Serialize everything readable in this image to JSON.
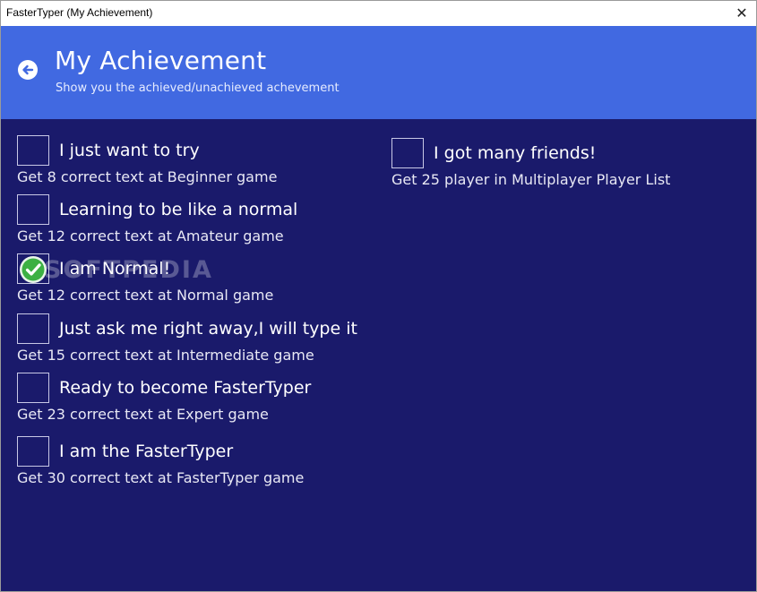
{
  "window": {
    "title": "FasterTyper (My Achievement)",
    "close_glyph": "✕"
  },
  "header": {
    "title": "My Achievement",
    "subtitle": "Show you the achieved/unachieved achevement",
    "back_icon": "back-arrow-circle-icon"
  },
  "achievements": [
    {
      "name": "I just want to try",
      "desc": "Get 8 correct text at Beginner game",
      "achieved": false
    },
    {
      "name": "Learning to be like a normal",
      "desc": "Get 12 correct text at Amateur game",
      "achieved": false
    },
    {
      "name": "I am Normal!",
      "desc": "Get 12 correct text at Normal game",
      "achieved": true
    },
    {
      "name": "Just ask me right away,I will type it",
      "desc": "Get 15 correct text at Intermediate game",
      "achieved": false
    },
    {
      "name": "Ready to become FasterTyper",
      "desc": "Get 23 correct text at Expert game",
      "achieved": false
    },
    {
      "name": "I am the FasterTyper",
      "desc": "Get 30 correct text at FasterTyper game",
      "achieved": false
    },
    {
      "name": "I got many friends!",
      "desc": "Get 25 player in Multiplayer Player List",
      "achieved": false
    }
  ],
  "watermark": {
    "text": "SOFTPEDIA"
  },
  "colors": {
    "header": "#4169e1",
    "content": "#1a1a6b",
    "achieved_check": "#3cb043"
  }
}
